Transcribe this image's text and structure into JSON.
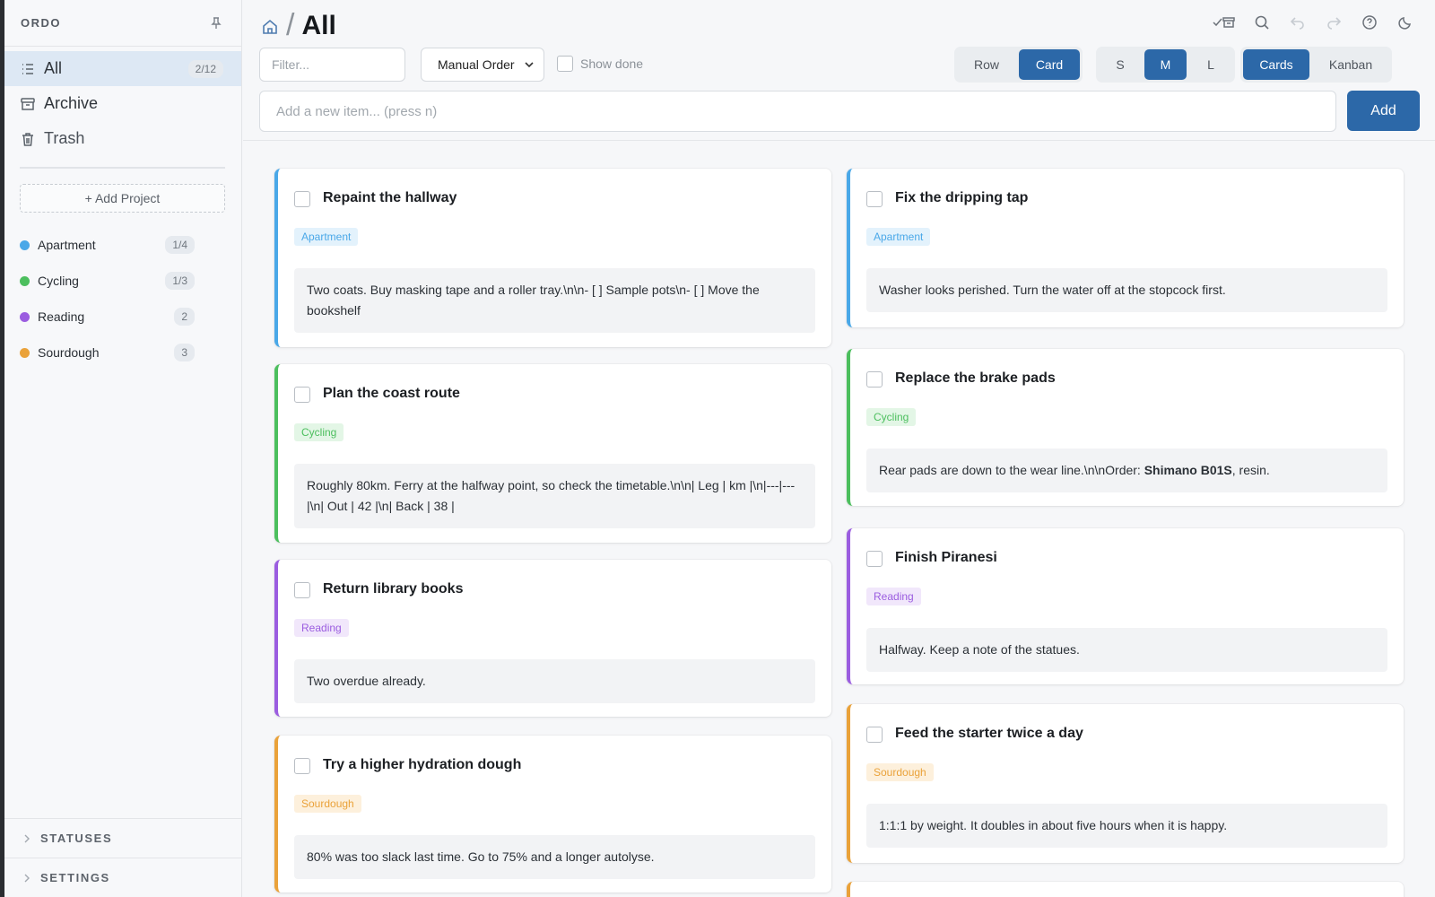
{
  "sidebar": {
    "brand": "ORDO",
    "nav": [
      {
        "label": "All",
        "count": "2/12"
      },
      {
        "label": "Archive"
      },
      {
        "label": "Trash"
      }
    ],
    "add_project": "+ Add Project",
    "projects": [
      {
        "name": "Apartment",
        "count": "1/4",
        "color": "#4aa8e8"
      },
      {
        "name": "Cycling",
        "count": "1/3",
        "color": "#4cbf5e"
      },
      {
        "name": "Reading",
        "count": "2",
        "color": "#9b5de0"
      },
      {
        "name": "Sourdough",
        "count": "3",
        "color": "#eaa23a"
      }
    ],
    "sections": [
      "STATUSES",
      "SETTINGS"
    ]
  },
  "header": {
    "title": "All",
    "filter_placeholder": "Filter...",
    "sort_value": "Manual Order",
    "show_done": "Show done",
    "layout_toggle": [
      "Row",
      "Card"
    ],
    "size_toggle": [
      "S",
      "M",
      "L"
    ],
    "view_toggle": [
      "Cards",
      "Kanban"
    ],
    "new_item_placeholder": "Add a new item... (press n)",
    "add_label": "Add"
  },
  "cards_left": [
    {
      "title": "Repaint the hallway",
      "tag": "Apartment",
      "note": "Two coats. Buy masking tape and a roller tray.\\n\\n- [ ] Sample pots\\n- [ ] Move the bookshelf"
    },
    {
      "title": "Plan the coast route",
      "tag": "Cycling",
      "note": "Roughly 80km. Ferry at the halfway point, so check the timetable.\\n\\n| Leg | km |\\n|---|---|\\n| Out | 42 |\\n| Back | 38 |"
    },
    {
      "title": "Return library books",
      "tag": "Reading",
      "note": "Two overdue already."
    },
    {
      "title": "Try a higher hydration dough",
      "tag": "Sourdough",
      "note": "80% was too slack last time. Go to 75% and a longer autolyse."
    }
  ],
  "cards_right": [
    {
      "title": "Fix the dripping tap",
      "tag": "Apartment",
      "note": "Washer looks perished. Turn the water off at the stopcock first."
    },
    {
      "title": "Replace the brake pads",
      "tag": "Cycling",
      "note_pre": "Rear pads are down to the wear line.\\n\\nOrder: ",
      "note_bold": "Shimano B01S",
      "note_post": ", resin."
    },
    {
      "title": "Finish Piranesi",
      "tag": "Reading",
      "note": "Halfway. Keep a note of the statues."
    },
    {
      "title": "Feed the starter twice a day",
      "tag": "Sourdough",
      "note": "1:1:1 by weight. It doubles in about five hours when it is happy."
    }
  ],
  "colors": {
    "accent": "#2c68a8",
    "apartment": "#4aa8e8",
    "cycling": "#4cbf5e",
    "reading": "#9b5de0",
    "sourdough": "#eaa23a"
  }
}
